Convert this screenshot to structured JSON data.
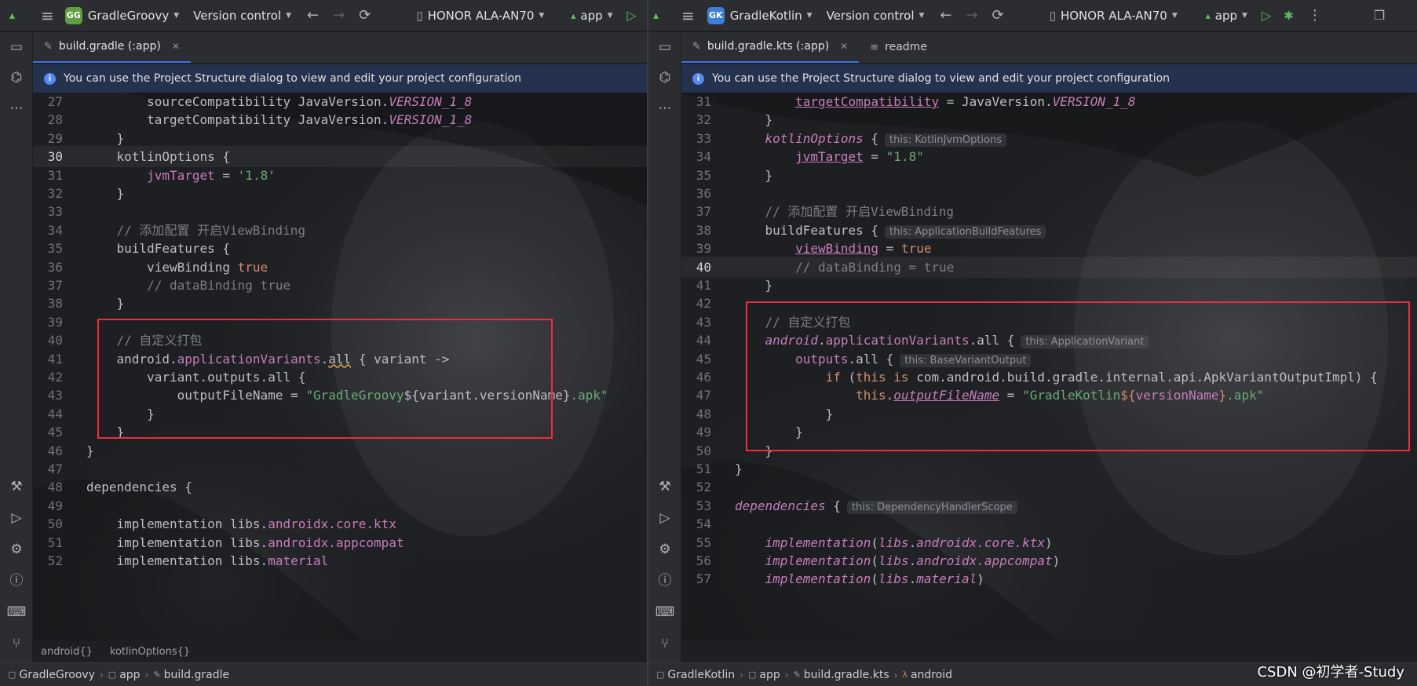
{
  "left": {
    "project": {
      "initials": "GG",
      "name": "GradleGroovy",
      "badge_color": "#5f9f3f"
    },
    "vcs": "Version control",
    "device": "HONOR ALA-AN70",
    "run_config": "app",
    "tab": {
      "label": "build.gradle (:app)"
    },
    "banner": "You can use the Project Structure dialog to view and edit your project configuration",
    "lines": [
      {
        "n": "27",
        "indent": "        ",
        "segs": [
          [
            "plain",
            "sourceCompatibility JavaVersion."
          ],
          [
            "fld it",
            "VERSION_1_8"
          ]
        ]
      },
      {
        "n": "28",
        "indent": "        ",
        "segs": [
          [
            "plain",
            "targetCompatibility JavaVersion."
          ],
          [
            "fld it",
            "VERSION_1_8"
          ]
        ]
      },
      {
        "n": "29",
        "indent": "    ",
        "segs": [
          [
            "plain",
            "}"
          ]
        ]
      },
      {
        "n": "30",
        "indent": "    ",
        "segs": [
          [
            "plain",
            "kotlinOptions {"
          ]
        ],
        "current": true
      },
      {
        "n": "31",
        "indent": "        ",
        "segs": [
          [
            "fld",
            "jvmTarget"
          ],
          [
            "plain",
            " = "
          ],
          [
            "str",
            "'1.8'"
          ]
        ]
      },
      {
        "n": "32",
        "indent": "    ",
        "segs": [
          [
            "plain",
            "}"
          ]
        ]
      },
      {
        "n": "33",
        "indent": "",
        "segs": []
      },
      {
        "n": "34",
        "indent": "    ",
        "segs": [
          [
            "cm",
            "// 添加配置 开启ViewBinding"
          ]
        ]
      },
      {
        "n": "35",
        "indent": "    ",
        "segs": [
          [
            "plain",
            "buildFeatures {"
          ]
        ]
      },
      {
        "n": "36",
        "indent": "        ",
        "segs": [
          [
            "plain",
            "viewBinding "
          ],
          [
            "kw",
            "true"
          ]
        ]
      },
      {
        "n": "37",
        "indent": "        ",
        "segs": [
          [
            "cm",
            "// dataBinding true"
          ]
        ]
      },
      {
        "n": "38",
        "indent": "    ",
        "segs": [
          [
            "plain",
            "}"
          ]
        ]
      },
      {
        "n": "39",
        "indent": "",
        "segs": []
      },
      {
        "n": "40",
        "indent": "    ",
        "segs": [
          [
            "cm",
            "// 自定义打包"
          ]
        ]
      },
      {
        "n": "41",
        "indent": "    ",
        "segs": [
          [
            "plain",
            "android."
          ],
          [
            "fld",
            "applicationVariants"
          ],
          [
            "plain",
            "."
          ],
          [
            "plain sq",
            "all"
          ],
          [
            "plain",
            " { variant ->"
          ]
        ]
      },
      {
        "n": "42",
        "indent": "        ",
        "segs": [
          [
            "plain",
            "variant.outputs.all {"
          ]
        ]
      },
      {
        "n": "43",
        "indent": "            ",
        "segs": [
          [
            "plain",
            "outputFileName = "
          ],
          [
            "str",
            "\"GradleGroovy"
          ],
          [
            "plain",
            "${variant.versionName}"
          ],
          [
            "str",
            ".apk\""
          ]
        ]
      },
      {
        "n": "44",
        "indent": "        ",
        "segs": [
          [
            "plain",
            "}"
          ]
        ]
      },
      {
        "n": "45",
        "indent": "    ",
        "segs": [
          [
            "plain",
            "}"
          ]
        ]
      },
      {
        "n": "46",
        "indent": "",
        "segs": [
          [
            "plain",
            "}"
          ]
        ]
      },
      {
        "n": "47",
        "indent": "",
        "segs": []
      },
      {
        "n": "48",
        "indent": "",
        "segs": [
          [
            "plain",
            "dependencies {"
          ]
        ]
      },
      {
        "n": "49",
        "indent": "",
        "segs": []
      },
      {
        "n": "50",
        "indent": "    ",
        "segs": [
          [
            "plain",
            "implementation libs."
          ],
          [
            "fld",
            "androidx.core.ktx"
          ]
        ]
      },
      {
        "n": "51",
        "indent": "    ",
        "segs": [
          [
            "plain",
            "implementation libs."
          ],
          [
            "fld",
            "androidx.appcompat"
          ]
        ]
      },
      {
        "n": "52",
        "indent": "    ",
        "segs": [
          [
            "plain",
            "implementation libs."
          ],
          [
            "fld",
            "material"
          ]
        ]
      }
    ],
    "crumbs": [
      "android{}",
      "kotlinOptions{}"
    ],
    "status": [
      "GradleGroovy",
      "app",
      "build.gradle"
    ]
  },
  "right": {
    "project": {
      "initials": "GK",
      "name": "GradleKotlin",
      "badge_color": "#3d7fd6"
    },
    "vcs": "Version control",
    "device": "HONOR ALA-AN70",
    "run_config": "app",
    "tab": {
      "label": "build.gradle.kts (:app)"
    },
    "tab2": {
      "label": "readme"
    },
    "banner": "You can use the Project Structure dialog to view and edit your project configuration",
    "lines": [
      {
        "n": "31",
        "indent": "        ",
        "segs": [
          [
            "fld u",
            "targetCompatibility"
          ],
          [
            "plain",
            " = JavaVersion."
          ],
          [
            "fld it",
            "VERSION_1_8"
          ]
        ]
      },
      {
        "n": "32",
        "indent": "    ",
        "segs": [
          [
            "plain",
            "}"
          ]
        ]
      },
      {
        "n": "33",
        "indent": "    ",
        "segs": [
          [
            "fld it",
            "kotlinOptions"
          ],
          [
            "plain",
            " {"
          ]
        ],
        "hint": "this: KotlinJvmOptions"
      },
      {
        "n": "34",
        "indent": "        ",
        "segs": [
          [
            "fld u",
            "jvmTarget"
          ],
          [
            "plain",
            " = "
          ],
          [
            "str",
            "\"1.8\""
          ]
        ]
      },
      {
        "n": "35",
        "indent": "    ",
        "segs": [
          [
            "plain",
            "}"
          ]
        ]
      },
      {
        "n": "36",
        "indent": "",
        "segs": []
      },
      {
        "n": "37",
        "indent": "    ",
        "segs": [
          [
            "cm",
            "// 添加配置 开启ViewBinding"
          ]
        ]
      },
      {
        "n": "38",
        "indent": "    ",
        "segs": [
          [
            "plain",
            "buildFeatures {"
          ]
        ],
        "hint": "this: ApplicationBuildFeatures"
      },
      {
        "n": "39",
        "indent": "        ",
        "segs": [
          [
            "fld u",
            "viewBinding"
          ],
          [
            "plain",
            " = "
          ],
          [
            "kw",
            "true"
          ]
        ]
      },
      {
        "n": "40",
        "indent": "        ",
        "segs": [
          [
            "cm",
            "// dataBinding = true"
          ]
        ],
        "current": true
      },
      {
        "n": "41",
        "indent": "    ",
        "segs": [
          [
            "plain",
            "}"
          ]
        ]
      },
      {
        "n": "42",
        "indent": "",
        "segs": []
      },
      {
        "n": "43",
        "indent": "    ",
        "segs": [
          [
            "cm",
            "// 自定义打包"
          ]
        ]
      },
      {
        "n": "44",
        "indent": "    ",
        "segs": [
          [
            "fld it",
            "android"
          ],
          [
            "plain",
            "."
          ],
          [
            "fld",
            "applicationVariants"
          ],
          [
            "plain",
            ".all {"
          ]
        ],
        "hint": "this: ApplicationVariant"
      },
      {
        "n": "45",
        "indent": "        ",
        "segs": [
          [
            "fld",
            "outputs"
          ],
          [
            "plain",
            ".all {"
          ]
        ],
        "hint": "this: BaseVariantOutput"
      },
      {
        "n": "46",
        "indent": "            ",
        "segs": [
          [
            "kw",
            "if"
          ],
          [
            "plain",
            " ("
          ],
          [
            "kw",
            "this is"
          ],
          [
            "plain",
            " com.android.build.gradle.internal.api.ApkVariantOutputImpl) {"
          ]
        ]
      },
      {
        "n": "47",
        "indent": "                ",
        "segs": [
          [
            "kw",
            "this"
          ],
          [
            "plain",
            "."
          ],
          [
            "fld it u",
            "outputFileName"
          ],
          [
            "plain",
            " = "
          ],
          [
            "str",
            "\"GradleKotlin"
          ],
          [
            "kw",
            "${"
          ],
          [
            "fld",
            "versionName"
          ],
          [
            "kw",
            "}"
          ],
          [
            "str",
            ".apk\""
          ]
        ]
      },
      {
        "n": "48",
        "indent": "            ",
        "segs": [
          [
            "plain",
            "}"
          ]
        ]
      },
      {
        "n": "49",
        "indent": "        ",
        "segs": [
          [
            "plain",
            "}"
          ]
        ]
      },
      {
        "n": "50",
        "indent": "    ",
        "segs": [
          [
            "plain",
            "}"
          ]
        ]
      },
      {
        "n": "51",
        "indent": "",
        "segs": [
          [
            "plain",
            "}"
          ]
        ]
      },
      {
        "n": "52",
        "indent": "",
        "segs": []
      },
      {
        "n": "53",
        "indent": "",
        "segs": [
          [
            "fld it",
            "dependencies"
          ],
          [
            "plain",
            " {"
          ]
        ],
        "hint": "this: DependencyHandlerScope"
      },
      {
        "n": "54",
        "indent": "",
        "segs": []
      },
      {
        "n": "55",
        "indent": "    ",
        "segs": [
          [
            "fld it",
            "implementation"
          ],
          [
            "plain",
            "("
          ],
          [
            "fld it",
            "libs"
          ],
          [
            "plain",
            "."
          ],
          [
            "fld it",
            "androidx.core.ktx"
          ],
          [
            "plain",
            ")"
          ]
        ]
      },
      {
        "n": "56",
        "indent": "    ",
        "segs": [
          [
            "fld it",
            "implementation"
          ],
          [
            "plain",
            "("
          ],
          [
            "fld it",
            "libs"
          ],
          [
            "plain",
            "."
          ],
          [
            "fld it",
            "androidx.appcompat"
          ],
          [
            "plain",
            ")"
          ]
        ]
      },
      {
        "n": "57",
        "indent": "    ",
        "segs": [
          [
            "fld it",
            "implementation"
          ],
          [
            "plain",
            "("
          ],
          [
            "fld it",
            "libs"
          ],
          [
            "plain",
            "."
          ],
          [
            "fld it",
            "material"
          ],
          [
            "plain",
            ")"
          ]
        ]
      }
    ],
    "status": [
      "GradleKotlin",
      "app",
      "build.gradle.kts",
      "android"
    ]
  },
  "watermark": "CSDN @初学者-Study"
}
